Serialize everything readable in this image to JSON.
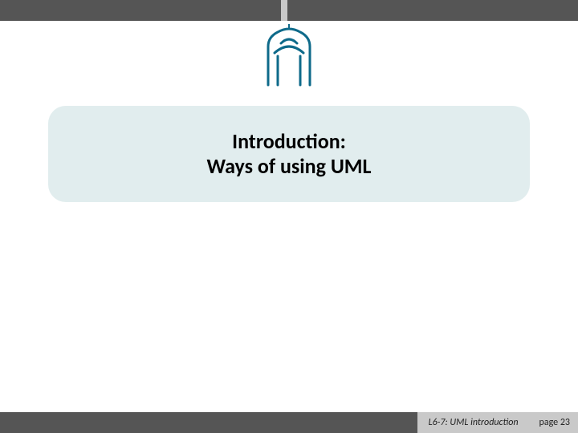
{
  "title": {
    "line1": "Introduction:",
    "line2": "Ways of using UML"
  },
  "footer": {
    "lecture": "L6-7: UML introduction",
    "page_label": "page 23"
  },
  "icons": {
    "logo": "university-logo"
  }
}
